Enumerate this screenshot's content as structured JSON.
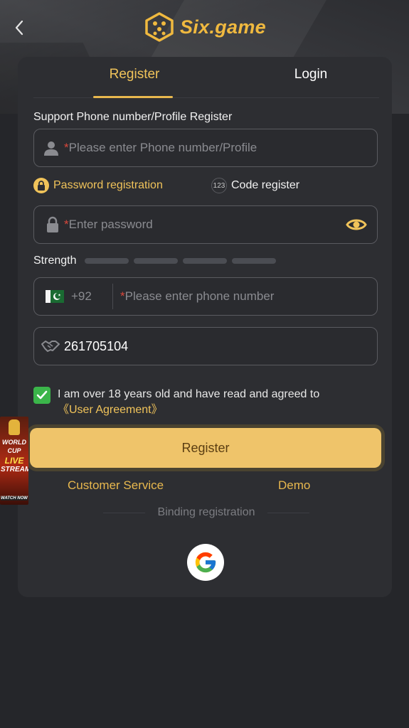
{
  "header": {
    "brand": "Six.game"
  },
  "tabs": {
    "register": "Register",
    "login": "Login"
  },
  "form": {
    "section_label": "Support Phone number/Profile Register",
    "phone_profile": {
      "required_mark": "*",
      "placeholder": "Please enter Phone number/Profile"
    },
    "modes": {
      "password": "Password registration",
      "code": "Code register",
      "code_icon_text": "123"
    },
    "password": {
      "required_mark": "*",
      "placeholder": "Enter password"
    },
    "strength_label": "Strength",
    "mobile": {
      "country_code": "+92",
      "required_mark": "*",
      "placeholder": "Please enter phone number"
    },
    "invite_code": {
      "value": "261705104"
    },
    "agreement": {
      "text": "I am over 18 years old and have read and agreed to",
      "link": "《User Agreement》",
      "checked": true
    },
    "submit_label": "Register"
  },
  "links": {
    "customer_service": "Customer Service",
    "demo": "Demo"
  },
  "binding": {
    "label": "Binding registration"
  },
  "promo": {
    "line1": "WORLD",
    "line2": "CUP",
    "line3": "LIVE",
    "line4": "STREAM",
    "cta": "WATCH NOW"
  },
  "colors": {
    "accent": "#f0c35a",
    "background": "#25262a",
    "card": "#2d2e32",
    "button": "#efc46a",
    "check": "#3bb54a",
    "required": "#d9473b"
  }
}
